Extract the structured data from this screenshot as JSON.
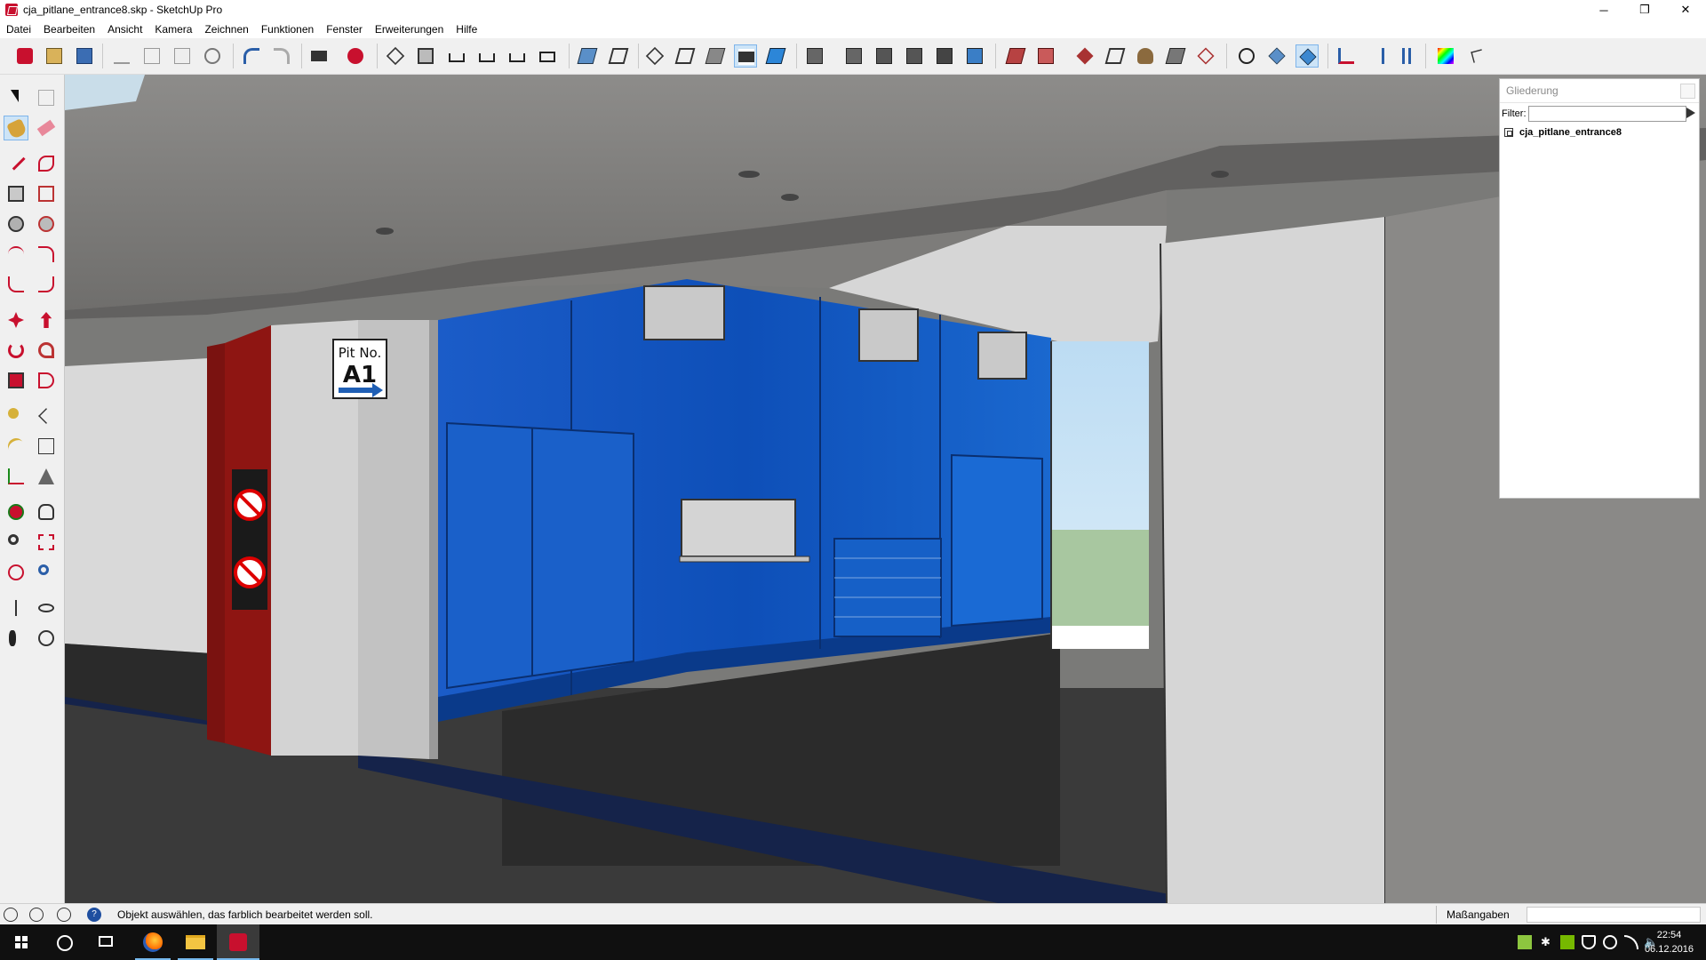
{
  "window": {
    "title": "cja_pitlane_entrance8.skp - SketchUp Pro",
    "controls": {
      "minimize": "─",
      "maximize": "❐",
      "close": "✕"
    }
  },
  "menu": [
    "Datei",
    "Bearbeiten",
    "Ansicht",
    "Kamera",
    "Zeichnen",
    "Funktionen",
    "Fenster",
    "Erweiterungen",
    "Hilfe"
  ],
  "toolbar": {
    "active_tools": [
      "x-ray-style",
      "hidden-line-style",
      "iso-view"
    ]
  },
  "palette": {
    "active_tool": "paint-bucket"
  },
  "scene": {
    "sign_line1": "Pit No.",
    "sign_line2": "A1"
  },
  "outliner": {
    "title": "Gliederung",
    "filter_label": "Filter:",
    "filter_value": "",
    "items": [
      "cja_pitlane_entrance8"
    ]
  },
  "statusbar": {
    "message": "Objekt auswählen, das farblich bearbeitet werden soll.",
    "measurements_label": "Maßangaben",
    "measurements_value": ""
  },
  "taskbar": {
    "time": "22:54",
    "date": "06.12.2016"
  }
}
